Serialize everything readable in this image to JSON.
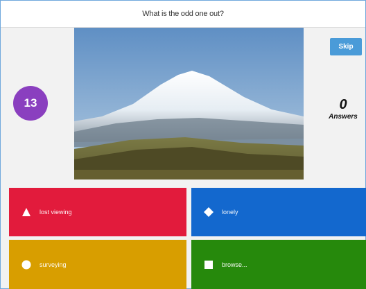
{
  "question": "What is the odd one out?",
  "timer": "13",
  "skip_label": "Skip",
  "answers": {
    "count": "0",
    "label": "Answers"
  },
  "options": [
    {
      "shape": "triangle-icon",
      "label": "lost viewing",
      "color": "#e21b3c"
    },
    {
      "shape": "diamond-icon",
      "label": "lonely",
      "color": "#1368ce"
    },
    {
      "shape": "circle-icon",
      "label": "surveying",
      "color": "#d89e00"
    },
    {
      "shape": "square-icon",
      "label": "browse...",
      "color": "#26890c"
    }
  ],
  "colors": {
    "timer": "#8a3fbf",
    "skip": "#4a9bd8"
  }
}
